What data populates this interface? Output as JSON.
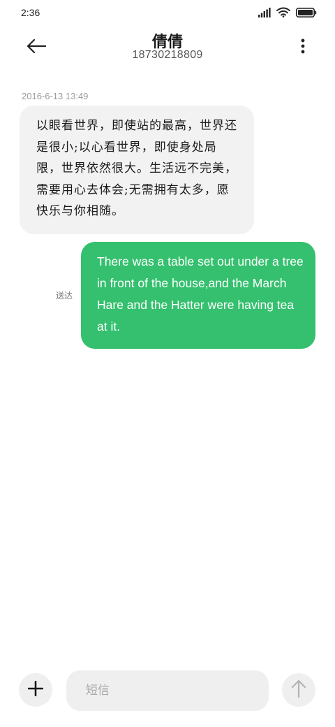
{
  "status_bar": {
    "time": "2:36",
    "icons": [
      "cellular-signal-icon",
      "wifi-icon",
      "battery-icon"
    ]
  },
  "header": {
    "contact_name": "倩倩",
    "contact_number": "18730218809",
    "icons": [
      "back-arrow-icon",
      "more-vertical-icon"
    ]
  },
  "conversation": {
    "timestamp": "2016-6-13 13:49",
    "messages": [
      {
        "direction": "incoming",
        "text": "以眼看世界，即使站的最高，世界还是很小;以心看世界，即使身处局限，世界依然很大。生活远不完美，需要用心去体会;无需拥有太多，愿快乐与你相随。"
      },
      {
        "direction": "outgoing",
        "status": "送达",
        "text": "There was a table set out under a tree in front of the house,and the March Hare and the Hatter were having tea at it."
      }
    ]
  },
  "composer": {
    "placeholder": "短信",
    "value": "",
    "icons": [
      "plus-icon",
      "send-arrow-up-icon"
    ]
  },
  "colors": {
    "outgoing_bubble": "#34c06e",
    "incoming_bubble": "#f2f2f2",
    "background": "#ffffff",
    "button_background": "#efefef"
  }
}
